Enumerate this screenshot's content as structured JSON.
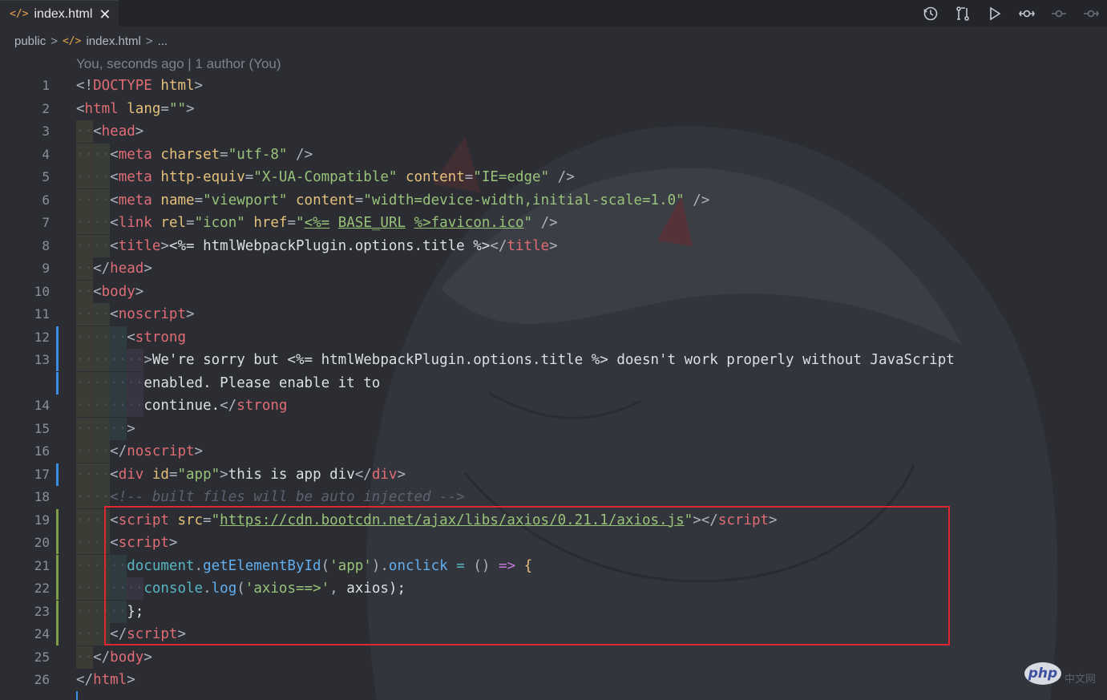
{
  "tab": {
    "icon_text": "</>",
    "label": "index.html",
    "close": "✕"
  },
  "actions": [
    "history-icon",
    "compare-changes-icon",
    "run-icon",
    "git-commit-icon",
    "previous-change-icon",
    "next-change-icon"
  ],
  "breadcrumb": {
    "folder": "public",
    "sep": ">",
    "icon_text": "</>",
    "file": "index.html",
    "more": "..."
  },
  "blame": "You, seconds ago | 1 author (You)",
  "lines": [
    {
      "n": "1",
      "indent": 0,
      "mark": "",
      "tokens": [
        [
          "p",
          "<!"
        ],
        [
          "tg",
          "DOCTYPE"
        ],
        [
          "df",
          " "
        ],
        [
          "at",
          "html"
        ],
        [
          "p",
          ">"
        ]
      ]
    },
    {
      "n": "2",
      "indent": 0,
      "mark": "",
      "tokens": [
        [
          "p",
          "<"
        ],
        [
          "tg",
          "html"
        ],
        [
          "df",
          " "
        ],
        [
          "at",
          "lang"
        ],
        [
          "p",
          "="
        ],
        [
          "st",
          "\"\""
        ],
        [
          "p",
          ">"
        ]
      ]
    },
    {
      "n": "3",
      "indent": 1,
      "mark": "",
      "tokens": [
        [
          "p",
          "<"
        ],
        [
          "tg",
          "head"
        ],
        [
          "p",
          ">"
        ]
      ]
    },
    {
      "n": "4",
      "indent": 2,
      "mark": "",
      "tokens": [
        [
          "p",
          "<"
        ],
        [
          "tg",
          "meta"
        ],
        [
          "df",
          " "
        ],
        [
          "at",
          "charset"
        ],
        [
          "p",
          "="
        ],
        [
          "st",
          "\"utf-8\""
        ],
        [
          "df",
          " "
        ],
        [
          "p",
          "/>"
        ]
      ]
    },
    {
      "n": "5",
      "indent": 2,
      "mark": "",
      "tokens": [
        [
          "p",
          "<"
        ],
        [
          "tg",
          "meta"
        ],
        [
          "df",
          " "
        ],
        [
          "at",
          "http-equiv"
        ],
        [
          "p",
          "="
        ],
        [
          "st",
          "\"X-UA-Compatible\""
        ],
        [
          "df",
          " "
        ],
        [
          "at",
          "content"
        ],
        [
          "p",
          "="
        ],
        [
          "st",
          "\"IE=edge\""
        ],
        [
          "df",
          " "
        ],
        [
          "p",
          "/>"
        ]
      ]
    },
    {
      "n": "6",
      "indent": 2,
      "mark": "",
      "tokens": [
        [
          "p",
          "<"
        ],
        [
          "tg",
          "meta"
        ],
        [
          "df",
          " "
        ],
        [
          "at",
          "name"
        ],
        [
          "p",
          "="
        ],
        [
          "st",
          "\"viewport\""
        ],
        [
          "df",
          " "
        ],
        [
          "at",
          "content"
        ],
        [
          "p",
          "="
        ],
        [
          "st",
          "\"width=device-width,initial-scale=1.0\""
        ],
        [
          "df",
          " "
        ],
        [
          "p",
          "/>"
        ]
      ]
    },
    {
      "n": "7",
      "indent": 2,
      "mark": "",
      "tokens": [
        [
          "p",
          "<"
        ],
        [
          "tg",
          "link"
        ],
        [
          "df",
          " "
        ],
        [
          "at",
          "rel"
        ],
        [
          "p",
          "="
        ],
        [
          "st",
          "\"icon\""
        ],
        [
          "df",
          " "
        ],
        [
          "at",
          "href"
        ],
        [
          "p",
          "="
        ],
        [
          "st",
          "\""
        ],
        [
          "stu",
          "<%="
        ],
        [
          "st",
          " "
        ],
        [
          "stu",
          "BASE_URL"
        ],
        [
          "st",
          " "
        ],
        [
          "stu",
          "%>favicon.ico"
        ],
        [
          "st",
          "\""
        ],
        [
          "df",
          " "
        ],
        [
          "p",
          "/>"
        ]
      ]
    },
    {
      "n": "8",
      "indent": 2,
      "mark": "",
      "tokens": [
        [
          "p",
          "<"
        ],
        [
          "tg",
          "title"
        ],
        [
          "p",
          ">"
        ],
        [
          "df",
          "<%= htmlWebpackPlugin.options.title %>"
        ],
        [
          "p",
          "</"
        ],
        [
          "tg",
          "title"
        ],
        [
          "p",
          ">"
        ]
      ]
    },
    {
      "n": "9",
      "indent": 1,
      "mark": "",
      "tokens": [
        [
          "p",
          "</"
        ],
        [
          "tg",
          "head"
        ],
        [
          "p",
          ">"
        ]
      ]
    },
    {
      "n": "10",
      "indent": 1,
      "mark": "",
      "tokens": [
        [
          "p",
          "<"
        ],
        [
          "tg",
          "body"
        ],
        [
          "p",
          ">"
        ]
      ]
    },
    {
      "n": "11",
      "indent": 2,
      "mark": "",
      "tokens": [
        [
          "p",
          "<"
        ],
        [
          "tg",
          "noscript"
        ],
        [
          "p",
          ">"
        ]
      ]
    },
    {
      "n": "12",
      "indent": 3,
      "mark": "blue",
      "tokens": [
        [
          "p",
          "<"
        ],
        [
          "tg",
          "strong"
        ]
      ]
    },
    {
      "n": "13",
      "indent": 4,
      "mark": "blue",
      "tokens": [
        [
          "p",
          ">"
        ],
        [
          "df",
          "We're sorry but <%= htmlWebpackPlugin.options.title %> doesn't work properly without JavaScript"
        ]
      ]
    },
    {
      "n": "",
      "indent": 4,
      "mark": "blue",
      "tokens": [
        [
          "df",
          "enabled. Please enable it to"
        ]
      ]
    },
    {
      "n": "14",
      "indent": 4,
      "mark": "",
      "tokens": [
        [
          "df",
          "continue."
        ],
        [
          "p",
          "</"
        ],
        [
          "tg",
          "strong"
        ]
      ]
    },
    {
      "n": "15",
      "indent": 3,
      "mark": "",
      "tokens": [
        [
          "p",
          ">"
        ]
      ]
    },
    {
      "n": "16",
      "indent": 2,
      "mark": "",
      "tokens": [
        [
          "p",
          "</"
        ],
        [
          "tg",
          "noscript"
        ],
        [
          "p",
          ">"
        ]
      ]
    },
    {
      "n": "17",
      "indent": 2,
      "mark": "blue",
      "tokens": [
        [
          "p",
          "<"
        ],
        [
          "tg",
          "div"
        ],
        [
          "df",
          " "
        ],
        [
          "at",
          "id"
        ],
        [
          "p",
          "="
        ],
        [
          "st",
          "\"app\""
        ],
        [
          "p",
          ">"
        ],
        [
          "df",
          "this is app div"
        ],
        [
          "p",
          "</"
        ],
        [
          "tg",
          "div"
        ],
        [
          "p",
          ">"
        ]
      ]
    },
    {
      "n": "18",
      "indent": 2,
      "mark": "",
      "tokens": [
        [
          "cm",
          "<!-- built files will be auto injected -->"
        ]
      ]
    },
    {
      "n": "19",
      "indent": 2,
      "mark": "green",
      "tokens": [
        [
          "p",
          "<"
        ],
        [
          "tg",
          "script"
        ],
        [
          "df",
          " "
        ],
        [
          "at",
          "src"
        ],
        [
          "p",
          "="
        ],
        [
          "st",
          "\""
        ],
        [
          "stu",
          "https://cdn.bootcdn.net/ajax/libs/axios/0.21.1/axios.js"
        ],
        [
          "st",
          "\""
        ],
        [
          "p",
          "></"
        ],
        [
          "tg",
          "script"
        ],
        [
          "p",
          ">"
        ]
      ]
    },
    {
      "n": "20",
      "indent": 2,
      "mark": "green",
      "tokens": [
        [
          "p",
          "<"
        ],
        [
          "tg",
          "script"
        ],
        [
          "p",
          ">"
        ]
      ]
    },
    {
      "n": "21",
      "indent": 3,
      "mark": "green",
      "tokens": [
        [
          "vr",
          "document"
        ],
        [
          "p",
          "."
        ],
        [
          "fn",
          "getElementById"
        ],
        [
          "p",
          "("
        ],
        [
          "st",
          "'app'"
        ],
        [
          "p",
          ")."
        ],
        [
          "fn",
          "onclick"
        ],
        [
          "df",
          " "
        ],
        [
          "vr",
          "="
        ],
        [
          "df",
          " "
        ],
        [
          "p",
          "()"
        ],
        [
          "df",
          " "
        ],
        [
          "kw",
          "=>"
        ],
        [
          "df",
          " "
        ],
        [
          "at",
          "{"
        ]
      ]
    },
    {
      "n": "22",
      "indent": 4,
      "mark": "green",
      "tokens": [
        [
          "vr",
          "console"
        ],
        [
          "p",
          "."
        ],
        [
          "fn",
          "log"
        ],
        [
          "p",
          "("
        ],
        [
          "st",
          "'axios==>'"
        ],
        [
          "p",
          ","
        ],
        [
          "df",
          " axios);"
        ]
      ]
    },
    {
      "n": "23",
      "indent": 3,
      "mark": "green",
      "tokens": [
        [
          "df",
          "};"
        ]
      ]
    },
    {
      "n": "24",
      "indent": 2,
      "mark": "green",
      "tokens": [
        [
          "p",
          "</"
        ],
        [
          "tg",
          "script"
        ],
        [
          "p",
          ">"
        ]
      ]
    },
    {
      "n": "25",
      "indent": 1,
      "mark": "",
      "tokens": [
        [
          "p",
          "</"
        ],
        [
          "tg",
          "body"
        ],
        [
          "p",
          ">"
        ]
      ]
    },
    {
      "n": "26",
      "indent": 0,
      "mark": "",
      "tokens": [
        [
          "p",
          "</"
        ],
        [
          "tg",
          "html"
        ],
        [
          "p",
          ">"
        ]
      ]
    }
  ],
  "watermark": {
    "logo": "php",
    "suffix": "中文网"
  },
  "colors": {
    "highlight_box": "#e0262f",
    "gutter_blue": "#3a8ee6",
    "gutter_green": "#7fa04a"
  }
}
